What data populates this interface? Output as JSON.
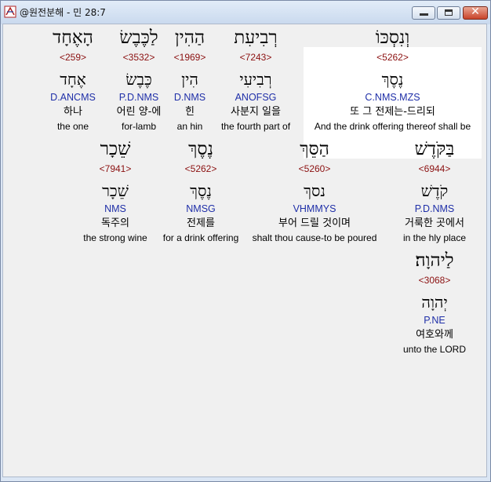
{
  "window": {
    "title": "@원전분해 - 민 28:7"
  },
  "rows": [
    [
      {
        "heb": "הָאֶחָד",
        "strong": "<259>",
        "lemma": "אֶחָד",
        "morph": "D.ANCMS",
        "kor": "하나",
        "eng": "the one"
      },
      {
        "heb": "לַכֶּבֶשׂ",
        "strong": "<3532>",
        "lemma": "כֶּבֶשׂ",
        "morph": "P.D.NMS",
        "kor": "어린 양-에",
        "eng": "for-lamb"
      },
      {
        "heb": "הַהִין",
        "strong": "<1969>",
        "lemma": "הִין",
        "morph": "D.NMS",
        "kor": "힌",
        "eng": "an hin"
      },
      {
        "heb": "רְבִיעִת",
        "strong": "<7243>",
        "lemma": "רְבִיעִי",
        "morph": "ANOFSG",
        "kor": "사분지 일을",
        "eng": "the fourth part of"
      },
      {
        "heb": "וְנִסְכּוֹ",
        "strong": "<5262>",
        "lemma": "נֶסֶךְ",
        "morph": "C.NMS.MZS",
        "kor": "또 그 전제는-드리되",
        "eng": "And the drink offering thereof shall be",
        "highlighted": true
      }
    ],
    [
      {
        "heb": "שֵׁכָר",
        "strong": "<7941>",
        "lemma": "שֵׁכָר",
        "morph": "NMS",
        "kor": "독주의",
        "eng": "the strong wine"
      },
      {
        "heb": "נֶסֶךְ",
        "strong": "<5262>",
        "lemma": "נֶסֶךְ",
        "morph": "NMSG",
        "kor": "전제를",
        "eng": "for a drink offering"
      },
      {
        "heb": "הַסֵּךְ",
        "strong": "<5260>",
        "lemma": "נסךְ",
        "morph": "VHMMYS",
        "kor": "부어 드릴 것이며",
        "eng": "shalt thou cause-to be poured"
      },
      {
        "heb": "בַּקֹּדֶשׁ",
        "strong": "<6944>",
        "lemma": "קֹדֶשׁ",
        "morph": "P.D.NMS",
        "kor": "거룩한 곳에서",
        "eng": "in the hly place"
      }
    ],
    [
      {
        "heb": "לַיהוָה׃",
        "strong": "<3068>",
        "lemma": "יְהוָה",
        "morph": "P.NE",
        "kor": "여호와께",
        "eng": "unto the LORD"
      }
    ]
  ]
}
